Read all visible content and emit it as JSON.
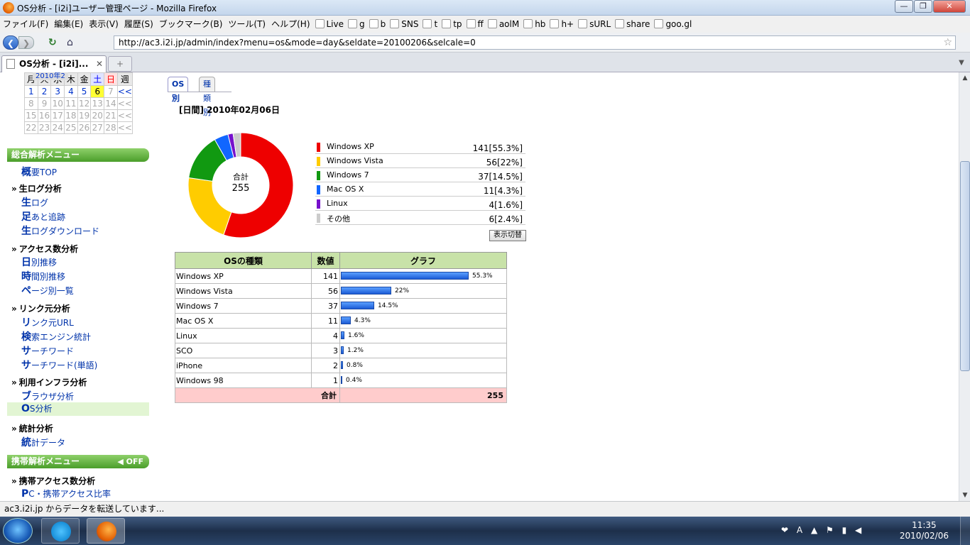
{
  "window": {
    "title": "OS分析 - [i2i]ユーザー管理ページ - Mozilla Firefox"
  },
  "menubar": {
    "items": [
      "ファイル(F)",
      "編集(E)",
      "表示(V)",
      "履歴(S)",
      "ブックマーク(B)",
      "ツール(T)",
      "ヘルプ(H)"
    ],
    "bookmarks": [
      "Live",
      "g",
      "b",
      "SNS",
      "t",
      "tp",
      "ff",
      "aolM",
      "hb",
      "h+",
      "sURL",
      "share",
      "goo.gl"
    ]
  },
  "navbar": {
    "url": "http://ac3.i2i.jp/admin/index?menu=os&mode=day&seldate=20100206&selcale=0"
  },
  "tabs": {
    "active_label": "OS分析 - [i2i]..."
  },
  "calendar": {
    "month_label": "2010年2",
    "headers": [
      "月",
      "火",
      "水",
      "木",
      "金",
      "土",
      "日",
      "週"
    ],
    "rows": [
      [
        "1",
        "2",
        "3",
        "4",
        "5",
        "6",
        "7",
        "<<"
      ],
      [
        "8",
        "9",
        "10",
        "11",
        "12",
        "13",
        "14",
        "<<"
      ],
      [
        "15",
        "16",
        "17",
        "18",
        "19",
        "20",
        "21",
        "<<"
      ],
      [
        "22",
        "23",
        "24",
        "25",
        "26",
        "27",
        "28",
        "<<"
      ]
    ],
    "today": "6"
  },
  "sidebar": {
    "menu_head": "総合解析メニュー",
    "top_link": {
      "big": "概",
      "rest": "要TOP"
    },
    "sections": [
      {
        "title": "生ログ分析",
        "links": [
          {
            "big": "生",
            "rest": "ログ"
          },
          {
            "big": "足",
            "rest": "あと追跡"
          },
          {
            "big": "生",
            "rest": "ログダウンロード"
          }
        ]
      },
      {
        "title": "アクセス数分析",
        "links": [
          {
            "big": "日",
            "rest": "別推移"
          },
          {
            "big": "時",
            "rest": "間別推移"
          },
          {
            "big": "ペ",
            "rest": "ージ別一覧"
          }
        ]
      },
      {
        "title": "リンク元分析",
        "links": [
          {
            "big": "リ",
            "rest": "ンク元URL"
          },
          {
            "big": "検",
            "rest": "索エンジン統計"
          },
          {
            "big": "サ",
            "rest": "ーチワード"
          },
          {
            "big": "サ",
            "rest": "ーチワード(単語)"
          }
        ]
      },
      {
        "title": "利用インフラ分析",
        "links": [
          {
            "big": "ブ",
            "rest": "ラウザ分析"
          },
          {
            "big": "O",
            "rest": "S分析"
          }
        ]
      },
      {
        "title": "統計分析",
        "links": [
          {
            "big": "統",
            "rest": "計データ"
          }
        ]
      }
    ],
    "mobile_head": "携帯解析メニュー",
    "mobile_toggle": "OFF",
    "mobile_section": {
      "title": "携帯アクセス数分析",
      "links": [
        {
          "big": "P",
          "rest": "C・携帯アクセス比率"
        }
      ]
    }
  },
  "subtabs": [
    "OS別",
    "種類別"
  ],
  "heading": "[日間] 2010年02月06日",
  "donut": {
    "center_label": "合計",
    "center_value": "255"
  },
  "colors": {
    "xp": "#ee0000",
    "vista": "#ffcc00",
    "seven": "#119911",
    "mac": "#1166ff",
    "linux": "#7711cc",
    "other": "#cccccc"
  },
  "legend": [
    {
      "name": "Windows XP",
      "value": "141[55.3%]"
    },
    {
      "name": "Windows Vista",
      "value": "56[22%]"
    },
    {
      "name": "Windows 7",
      "value": "37[14.5%]"
    },
    {
      "name": "Mac OS X",
      "value": "11[4.3%]"
    },
    {
      "name": "Linux",
      "value": "4[1.6%]"
    },
    {
      "name": "その他",
      "value": "6[2.4%]"
    }
  ],
  "toggle_label": "表示切替",
  "table": {
    "headers": [
      "OSの種類",
      "数値",
      "グラフ"
    ],
    "rows": [
      {
        "os": "Windows XP",
        "count": "141",
        "pct": "55.3%"
      },
      {
        "os": "Windows Vista",
        "count": "56",
        "pct": "22%"
      },
      {
        "os": "Windows 7",
        "count": "37",
        "pct": "14.5%"
      },
      {
        "os": "Mac OS X",
        "count": "11",
        "pct": "4.3%"
      },
      {
        "os": "Linux",
        "count": "4",
        "pct": "1.6%"
      },
      {
        "os": "SCO",
        "count": "3",
        "pct": "1.2%"
      },
      {
        "os": "iPhone",
        "count": "2",
        "pct": "0.8%"
      },
      {
        "os": "Windows 98",
        "count": "1",
        "pct": "0.4%"
      }
    ],
    "total_label": "合計",
    "total_value": "255"
  },
  "chart_data": {
    "type": "pie",
    "categories": [
      "Windows XP",
      "Windows Vista",
      "Windows 7",
      "Mac OS X",
      "Linux",
      "その他"
    ],
    "values": [
      141,
      56,
      37,
      11,
      4,
      6
    ],
    "title": ""
  },
  "statusbar": {
    "text": "ac3.i2i.jp からデータを転送しています..."
  },
  "taskbar": {
    "time": "11:35",
    "date": "2010/02/06",
    "ime": "A"
  }
}
